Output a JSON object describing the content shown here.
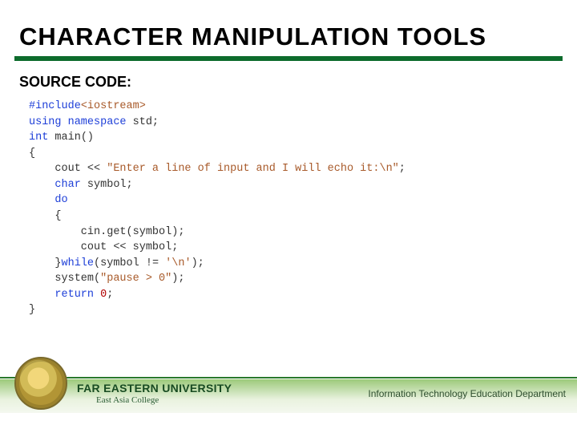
{
  "title": "CHARACTER MANIPULATION TOOLS",
  "subhead": "SOURCE CODE:",
  "code": {
    "l1a": "#include",
    "l1b": "<iostream>",
    "l2a": "using namespace",
    "l2b": " std;",
    "l3a": "int",
    "l3b": " main()",
    "l4": "{",
    "l5a": "    cout << ",
    "l5b": "\"Enter a line of input and I will echo it:\\n\"",
    "l5c": ";",
    "l6a": "    char",
    "l6b": " symbol;",
    "l7a": "    do",
    "l8": "    {",
    "l9": "        cin.get(symbol);",
    "l10": "        cout << symbol;",
    "l11a": "    }",
    "l11b": "while",
    "l11c": "(symbol != ",
    "l11d": "'\\n'",
    "l11e": ");",
    "l12a": "    system(",
    "l12b": "\"pause > 0\"",
    "l12c": ");",
    "l13a": "    return",
    "l13b": " ",
    "l13c": "0",
    "l13d": ";",
    "l14": "}"
  },
  "footer": {
    "university": "FAR EASTERN UNIVERSITY",
    "college": "East Asia College",
    "department": "Information Technology Education Department"
  }
}
